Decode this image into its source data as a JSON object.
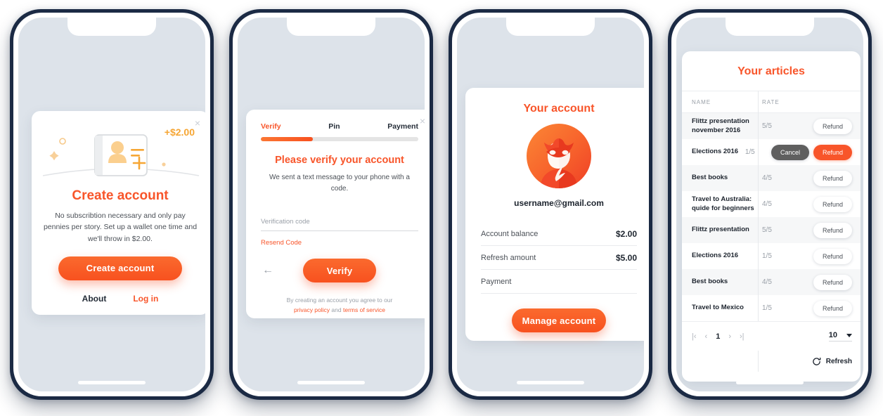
{
  "colors": {
    "brand_orange": "#f8552a",
    "accent_yellow": "#f6a634",
    "phone_frame": "#1b2a44",
    "screen_bg": "#dde3ea",
    "card_bg": "#ffffff",
    "dark_button": "#5f5f5f"
  },
  "phone1": {
    "close_label": "×",
    "illustration": {
      "amount_badge": "+$2.00",
      "icon_name": "new-account-card-illustration"
    },
    "title": "Create account",
    "subtitle": "No subscribtion necessary and only pay pennies per story. Set up a wallet one time and we'll throw in $2.00.",
    "primary_button": "Create account",
    "links": {
      "about": "About",
      "login": "Log in"
    }
  },
  "phone2": {
    "close_label": "×",
    "steps": [
      {
        "label": "Verify",
        "active": true
      },
      {
        "label": "Pin",
        "active": false
      },
      {
        "label": "Payment",
        "active": false
      }
    ],
    "progress_percent": 33,
    "title": "Please verify your account",
    "subtitle": "We sent a text message to your phone with a code.",
    "field_label": "Verification code",
    "field_value": "",
    "resend_link": "Resend Code",
    "back_arrow": "←",
    "primary_button": "Verify",
    "legal_prefix": "By creating an account you agree to our",
    "legal_privacy": "privacy policy",
    "legal_and": "and",
    "legal_terms": "terms of service"
  },
  "phone3": {
    "title": "Your account",
    "avatar_name": "superhero-avatar",
    "email": "username@gmail.com",
    "rows": [
      {
        "key": "Account balance",
        "value": "$2.00"
      },
      {
        "key": "Refresh amount",
        "value": "$5.00"
      },
      {
        "key": "Payment",
        "value": ""
      }
    ],
    "primary_button": "Manage account"
  },
  "phone4": {
    "title": "Your articles",
    "columns": [
      "NAME",
      "RATE"
    ],
    "rows": [
      {
        "name": "Flittz presentation november 2016",
        "rate": "5/5",
        "buttons": [
          "Refund"
        ]
      },
      {
        "name": "Elections 2016",
        "rate": "1/5",
        "buttons": [
          "Cancel",
          "Refund"
        ]
      },
      {
        "name": "Best books",
        "rate": "4/5",
        "buttons": [
          "Refund"
        ]
      },
      {
        "name": "Travel to Australia: quide for beginners",
        "rate": "4/5",
        "buttons": [
          "Refund"
        ]
      },
      {
        "name": "Flittz presentation",
        "rate": "5/5",
        "buttons": [
          "Refund"
        ]
      },
      {
        "name": "Elections 2016",
        "rate": "1/5",
        "buttons": [
          "Refund"
        ]
      },
      {
        "name": "Best books",
        "rate": "4/5",
        "buttons": [
          "Refund"
        ]
      },
      {
        "name": "Travel to Mexico",
        "rate": "1/5",
        "buttons": [
          "Refund"
        ]
      }
    ],
    "pagination": {
      "first": "|‹",
      "prev": "‹",
      "page": "1",
      "next": "›",
      "last": "›|",
      "page_size": "10"
    },
    "refresh_label": "Refresh"
  }
}
